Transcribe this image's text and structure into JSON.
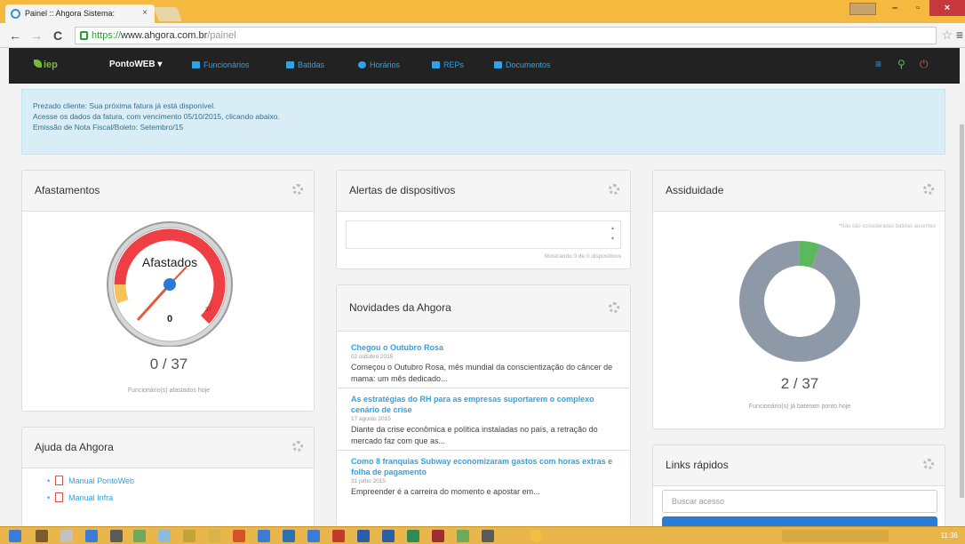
{
  "browser": {
    "tab_title": "Painel :: Ahgora Sistema:",
    "tab_close": "×",
    "url_scheme": "https://",
    "url_host": "www.ahgora.com.br",
    "url_path": "/painel",
    "back": "←",
    "forward": "→",
    "reload": "C",
    "star": "☆",
    "menu": "≡",
    "window_min": "–",
    "window_max": "▫",
    "window_close": "×"
  },
  "navbar": {
    "logo": "iep",
    "brand": "PontoWEB ▾",
    "items": [
      {
        "label": "Funcionários"
      },
      {
        "label": "Batidas"
      },
      {
        "label": "Horários"
      },
      {
        "label": "REPs"
      },
      {
        "label": "Documentos"
      }
    ],
    "right_icons": [
      "list-icon",
      "search-icon",
      "logout-icon"
    ],
    "right_glyphs": [
      "≡",
      "⚲",
      "⏻"
    ]
  },
  "alert": {
    "line1": "Prezado cliente: Sua próxima fatura já está disponível.",
    "line2": "Acesse os dados da fatura, com vencimento 05/10/2015, clicando abaixo.",
    "line3": "Emissão de Nota Fiscal/Boleto: Setembro/15"
  },
  "afastamentos": {
    "title": "Afastamentos",
    "gauge_label": "Afastados",
    "gauge_value": "0",
    "gauge_min": 0,
    "gauge_max": 37,
    "gauge_max_label": "37",
    "ratio": "0 / 37",
    "caption": "Funcionário(s) afastados hoje"
  },
  "ajuda": {
    "title": "Ajuda da Ahgora",
    "items": [
      {
        "label": "Manual PontoWeb"
      },
      {
        "label": "Manual Infra"
      }
    ]
  },
  "alertas": {
    "title": "Alertas de dispositivos",
    "footer": "Mostrando 0 de 0 dispositivos"
  },
  "novidades": {
    "title": "Novidades da Ahgora",
    "items": [
      {
        "title": "Chegou o Outubro Rosa",
        "date": "02 outubro 2015",
        "body": "Começou o Outubro Rosa, mês mundial da conscientização do câncer de mama: um mês dedicado..."
      },
      {
        "title": "As estratégias do RH para as empresas suportarem o complexo cenário de crise",
        "date": "17 agosto 2015",
        "body": "Diante da crise econômica e política instaladas no país, a retração do mercado faz com que as..."
      },
      {
        "title": "Como 8 franquias Subway economizaram gastos com horas extras e folha de pagamento",
        "date": "31 julho 2015",
        "body": "Empreender é a carreira do momento e apostar em..."
      }
    ]
  },
  "assiduidade": {
    "title": "Assiduidade",
    "note": "*Não são consideradas batidas ausentes",
    "present": 2,
    "total": 37,
    "ratio": "2 / 37",
    "caption": "Funcionário(s) já bateram ponto hoje",
    "colors": {
      "present": "#5cb85c",
      "absent": "#8e99a8"
    }
  },
  "links": {
    "title": "Links rápidos",
    "search_placeholder": "Buscar acesso"
  },
  "taskbar": {
    "time": "11:36"
  }
}
